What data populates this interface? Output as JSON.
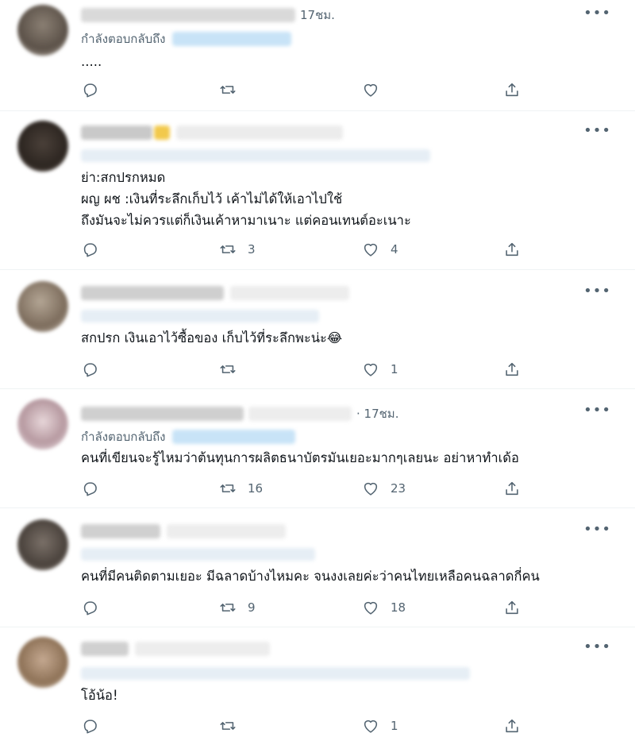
{
  "ui": {
    "more_glyph": "•••",
    "replying_to": "กำลังตอบกลับถึง"
  },
  "tweets": [
    {
      "time": "17ชม.",
      "text": ".....",
      "reply_count": "",
      "retweet_count": "",
      "like_count": ""
    },
    {
      "time": "",
      "text": "ย่า:สกปรกหมด\nผญ ผช :เงินที่ระลึกเก็บไว้ เค้าไม่ได้ให้เอาไปใช้\nถึงมันจะไม่ควรแต่ก็เงินเค้าหามาเนาะ แต่คอนเทนต์อะเนาะ",
      "retweet_count": "3",
      "like_count": "4"
    },
    {
      "time": "",
      "text": "สกปรก เงินเอาไว้ซื้อของ เก็บไว้ที่ระลึกพะน่ะ😂",
      "retweet_count": "",
      "like_count": "1"
    },
    {
      "time": "· 17ชม.",
      "text": "คนที่เขียนจะรู้ไหมว่าต้นทุนการผลิตธนาบัตรมันเยอะมากๆเลยนะ อย่าหาทำเด้อ",
      "retweet_count": "16",
      "like_count": "23"
    },
    {
      "time": "",
      "text": "คนที่มีคนติดตามเยอะ มีฉลาดบ้างไหมคะ จนงงเลยค่ะว่าคนไทยเหลือคนฉลาดกี่คน",
      "retweet_count": "9",
      "like_count": "18"
    },
    {
      "time": "",
      "text": "โอ้น้อ!",
      "retweet_count": "",
      "like_count": "1"
    }
  ],
  "colors": {
    "text": "#0f1419",
    "muted": "#536471",
    "divider": "#eff3f4",
    "mention_blur": "#c8e3f7"
  },
  "icons": [
    "reply-icon",
    "retweet-icon",
    "like-icon",
    "share-icon",
    "more-icon"
  ]
}
